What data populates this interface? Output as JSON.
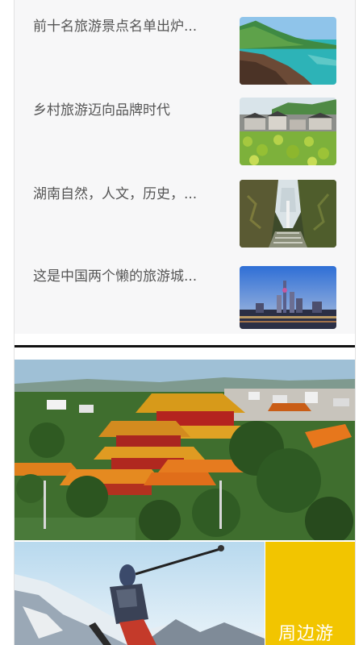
{
  "news": [
    {
      "title": "前十名旅游景点名单出炉...",
      "thumb_icon": "coastline-photo"
    },
    {
      "title": "乡村旅游迈向品牌时代",
      "thumb_icon": "lotus-village-photo"
    },
    {
      "title": "湖南自然，人文，历史，...",
      "thumb_icon": "canyon-bridge-photo"
    },
    {
      "title": "这是中国两个懒的旅游城...",
      "thumb_icon": "city-skyline-photo"
    }
  ],
  "banner": {
    "icon": "temple-aerial-photo"
  },
  "feature": {
    "icon": "skier-photo",
    "label": "周边游"
  },
  "colors": {
    "list_background": "#f7f7f8",
    "title_text": "#555555",
    "divider": "#111111",
    "tile_yellow": "#f2c500"
  }
}
